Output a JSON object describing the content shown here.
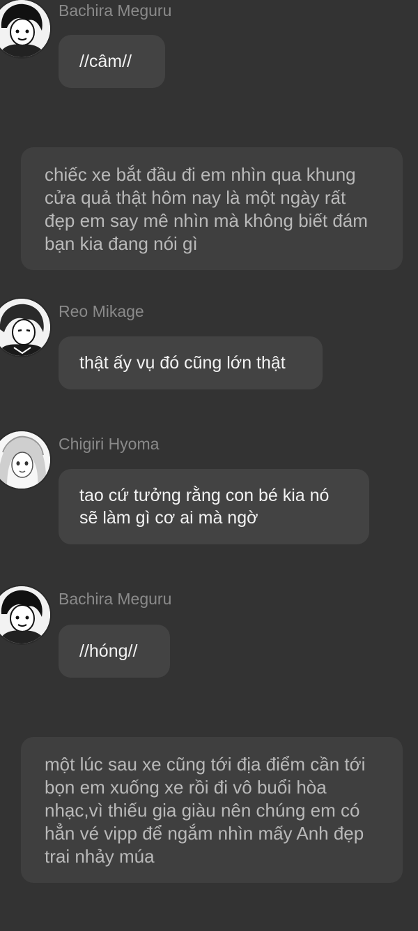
{
  "messages": [
    {
      "kind": "chat",
      "sender": "Bachira Meguru",
      "avatar_icon": "bachira-avatar-icon",
      "text": "//câm//"
    },
    {
      "kind": "narration",
      "text": "chiếc xe bắt đầu đi em nhìn qua khung cửa quả thật hôm nay là một ngày rất đẹp em say mê nhìn mà không biết đám bạn kia đang nói gì"
    },
    {
      "kind": "chat",
      "sender": "Reo Mikage",
      "avatar_icon": "reo-avatar-icon",
      "text": "thật ấy vụ đó cũng lớn thật"
    },
    {
      "kind": "chat",
      "sender": "Chigiri Hyoma",
      "avatar_icon": "chigiri-avatar-icon",
      "text": "tao cứ tưởng rằng con bé kia nó sẽ làm gì cơ ai mà ngờ"
    },
    {
      "kind": "chat",
      "sender": "Bachira Meguru",
      "avatar_icon": "bachira-avatar-icon",
      "text": "//hóng//"
    },
    {
      "kind": "narration",
      "text": "một lúc sau xe cũng tới địa điểm cần tới bọn em xuống xe rồi đi vô buổi hòa nhạc,vì thiếu gia giàu nên chúng em có hẳn vé vipp để ngắm nhìn mấy Anh đẹp trai nhảy múa"
    }
  ],
  "colors": {
    "background": "#333333",
    "bubble": "#434343",
    "narration": "#3f3f3f",
    "sender": "#8a8a8a"
  }
}
